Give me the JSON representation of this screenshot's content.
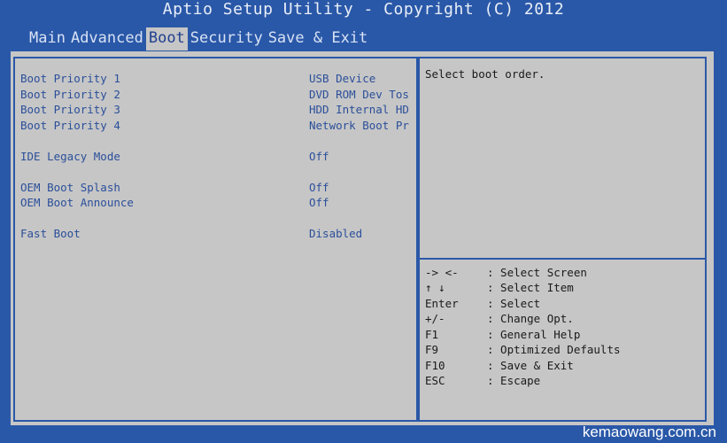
{
  "title": "Aptio Setup Utility - Copyright (C) 2012",
  "menu": [
    "Main",
    "Advanced",
    "Boot",
    "Security",
    "Save & Exit"
  ],
  "settings": [
    {
      "label": "Boot Priority 1",
      "value": "USB Device"
    },
    {
      "label": "Boot Priority 2",
      "value": "DVD ROM Dev Tos"
    },
    {
      "label": "Boot Priority 3",
      "value": "HDD Internal HD"
    },
    {
      "label": "Boot Priority 4",
      "value": "Network Boot Pr"
    },
    {
      "label": "IDE Legacy Mode",
      "value": "Off"
    },
    {
      "label": "OEM Boot Splash",
      "value": "Off"
    },
    {
      "label": "OEM Boot Announce",
      "value": "Off"
    },
    {
      "label": "Fast Boot",
      "value": "Disabled"
    }
  ],
  "help": "Select boot order.",
  "keys": [
    {
      "key": "-> <-",
      "desc": ": Select Screen"
    },
    {
      "key": "↑ ↓",
      "desc": ": Select Item"
    },
    {
      "key": "Enter",
      "desc": ": Select"
    },
    {
      "key": "+/-",
      "desc": ": Change Opt."
    },
    {
      "key": "F1",
      "desc": ": General Help"
    },
    {
      "key": "F9",
      "desc": ": Optimized Defaults"
    },
    {
      "key": "F10",
      "desc": ": Save & Exit"
    },
    {
      "key": "ESC",
      "desc": ": Escape"
    }
  ],
  "watermark": "kemaowang.com.cn"
}
